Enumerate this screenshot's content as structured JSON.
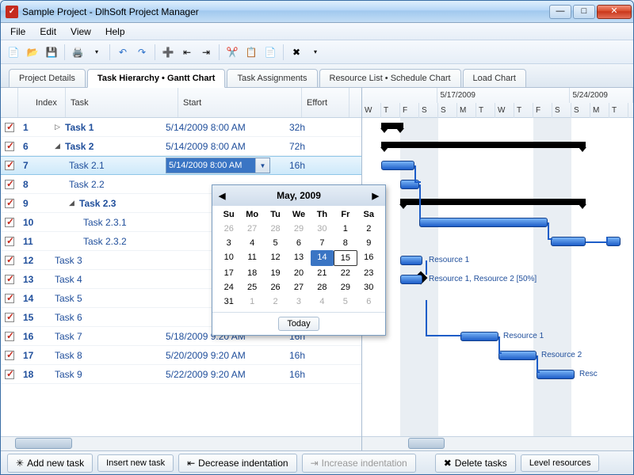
{
  "window": {
    "title": "Sample Project - DlhSoft Project Manager"
  },
  "menu": {
    "file": "File",
    "edit": "Edit",
    "view": "View",
    "help": "Help"
  },
  "tabs": {
    "details": "Project Details",
    "gantt": "Task Hierarchy • Gantt Chart",
    "assign": "Task Assignments",
    "resource": "Resource List • Schedule Chart",
    "load": "Load Chart"
  },
  "columns": {
    "index": "Index",
    "task": "Task",
    "start": "Start",
    "effort": "Effort"
  },
  "timeline": {
    "week1": "5/17/2009",
    "week2": "5/24/2009",
    "days": [
      "W",
      "T",
      "F",
      "S",
      "S",
      "M",
      "T",
      "W",
      "T",
      "F",
      "S",
      "S",
      "M",
      "T"
    ]
  },
  "rows": [
    {
      "idx": "1",
      "name": "Task 1",
      "start": "5/14/2009 8:00 AM",
      "effort": "32h",
      "bold": true,
      "indent": 0,
      "expander": "▷"
    },
    {
      "idx": "6",
      "name": "Task 2",
      "start": "5/14/2009 8:00 AM",
      "effort": "72h",
      "bold": true,
      "indent": 0,
      "expander": "◢"
    },
    {
      "idx": "7",
      "name": "Task 2.1",
      "start": "5/14/2009 8:00 AM",
      "effort": "16h",
      "bold": false,
      "indent": 1,
      "selected": true
    },
    {
      "idx": "8",
      "name": "Task 2.2",
      "start": "",
      "effort": "",
      "bold": false,
      "indent": 1
    },
    {
      "idx": "9",
      "name": "Task 2.3",
      "start": "",
      "effort": "",
      "bold": true,
      "indent": 1,
      "expander": "◢"
    },
    {
      "idx": "10",
      "name": "Task 2.3.1",
      "start": "",
      "effort": "",
      "bold": false,
      "indent": 2
    },
    {
      "idx": "11",
      "name": "Task 2.3.2",
      "start": "",
      "effort": "",
      "bold": false,
      "indent": 2
    },
    {
      "idx": "12",
      "name": "Task 3",
      "start": "",
      "effort": "",
      "bold": false,
      "indent": 0
    },
    {
      "idx": "13",
      "name": "Task 4",
      "start": "",
      "effort": "",
      "bold": false,
      "indent": 0
    },
    {
      "idx": "14",
      "name": "Task 5",
      "start": "",
      "effort": "",
      "bold": false,
      "indent": 0
    },
    {
      "idx": "15",
      "name": "Task 6",
      "start": "",
      "effort": "",
      "bold": false,
      "indent": 0
    },
    {
      "idx": "16",
      "name": "Task 7",
      "start": "5/18/2009 9:20 AM",
      "effort": "16h",
      "bold": false,
      "indent": 0
    },
    {
      "idx": "17",
      "name": "Task 8",
      "start": "5/20/2009 9:20 AM",
      "effort": "16h",
      "bold": false,
      "indent": 0
    },
    {
      "idx": "18",
      "name": "Task 9",
      "start": "5/22/2009 9:20 AM",
      "effort": "16h",
      "bold": false,
      "indent": 0
    }
  ],
  "barlabels": {
    "r1": "Resource 1",
    "r12": "Resource 1, Resource 2 [50%]",
    "r1b": "Resource 1",
    "r2": "Resource 2",
    "rese": "Resc"
  },
  "calendar": {
    "title": "May, 2009",
    "dayheads": [
      "Su",
      "Mo",
      "Tu",
      "We",
      "Th",
      "Fr",
      "Sa"
    ],
    "cells": [
      {
        "n": "26",
        "g": 1
      },
      {
        "n": "27",
        "g": 1
      },
      {
        "n": "28",
        "g": 1
      },
      {
        "n": "29",
        "g": 1
      },
      {
        "n": "30",
        "g": 1
      },
      {
        "n": "1"
      },
      {
        "n": "2"
      },
      {
        "n": "3"
      },
      {
        "n": "4"
      },
      {
        "n": "5"
      },
      {
        "n": "6"
      },
      {
        "n": "7"
      },
      {
        "n": "8"
      },
      {
        "n": "9"
      },
      {
        "n": "10"
      },
      {
        "n": "11"
      },
      {
        "n": "12"
      },
      {
        "n": "13"
      },
      {
        "n": "14",
        "sel": 1
      },
      {
        "n": "15",
        "t": 1
      },
      {
        "n": "16"
      },
      {
        "n": "17"
      },
      {
        "n": "18"
      },
      {
        "n": "19"
      },
      {
        "n": "20"
      },
      {
        "n": "21"
      },
      {
        "n": "22"
      },
      {
        "n": "23"
      },
      {
        "n": "24"
      },
      {
        "n": "25"
      },
      {
        "n": "26"
      },
      {
        "n": "27"
      },
      {
        "n": "28"
      },
      {
        "n": "29"
      },
      {
        "n": "30"
      },
      {
        "n": "31"
      },
      {
        "n": "1",
        "g": 1
      },
      {
        "n": "2",
        "g": 1
      },
      {
        "n": "3",
        "g": 1
      },
      {
        "n": "4",
        "g": 1
      },
      {
        "n": "5",
        "g": 1
      },
      {
        "n": "6",
        "g": 1
      }
    ],
    "today": "Today"
  },
  "buttons": {
    "add": "Add new task",
    "insert": "Insert new task",
    "decind": "Decrease indentation",
    "incind": "Increase indentation",
    "delete": "Delete tasks",
    "level": "Level resources"
  }
}
